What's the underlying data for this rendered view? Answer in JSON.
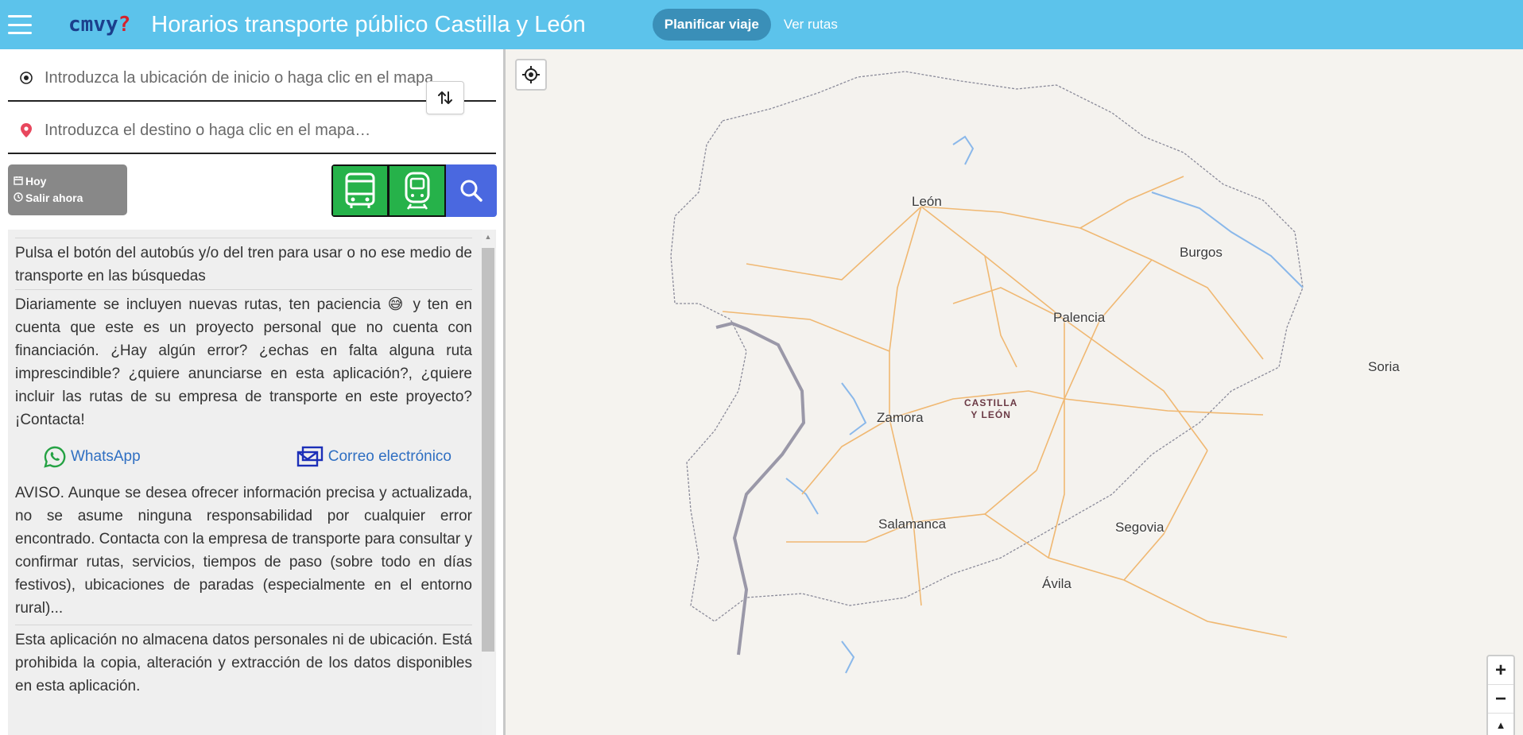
{
  "header": {
    "logo": {
      "part1": "cm",
      "part2": "vy",
      "part3": "?"
    },
    "title": "Horarios transporte público Castilla y León",
    "nav": {
      "plan": "Planificar viaje",
      "routes": "Ver rutas"
    }
  },
  "search": {
    "origin_placeholder": "Introduzca la ubicación de inicio o haga clic en el mapa",
    "destination_placeholder": "Introduzca el destino o haga clic en el mapa…",
    "when": {
      "date": "Hoy",
      "time": "Salir ahora"
    }
  },
  "info": {
    "tip": "Pulsa el botón del autobús y/o del tren para usar o no ese medio de transporte en las búsquedas",
    "news_before_emoji": "Diariamente se incluyen nuevas rutas, ten paciencia",
    "news_emoji": "😅",
    "news_after_emoji": "y ten en cuenta que este es un proyecto personal que no cuenta con financiación. ¿Hay algún error? ¿echas en falta alguna ruta imprescindible? ¿quiere anunciarse en esta aplicación?, ¿quiere incluir las rutas de su empresa de transporte en este proyecto? ¡Contacta!",
    "whatsapp": "WhatsApp",
    "email": "Correo electrónico",
    "warning": "AVISO. Aunque se desea ofrecer información precisa y actualizada, no se asume ninguna responsabilidad por cualquier error encontrado. Contacta con la empresa de transporte para consultar y confirmar rutas, servicios, tiempos de paso (sobre todo en días festivos), ubicaciones de paradas (especialmente en el entorno rural)...",
    "privacy": "Esta aplicación no almacena datos personales ni de ubicación. Está prohibida la copia, alteración y extracción de los datos disponibles en esta aplicación."
  },
  "map": {
    "cities": {
      "leon": "León",
      "burgos": "Burgos",
      "palencia": "Palencia",
      "soria": "Soria",
      "zamora": "Zamora",
      "salamanca": "Salamanca",
      "segovia": "Segovia",
      "avila": "Ávila"
    },
    "region_line1": "CASTILLA",
    "region_line2": "Y LEÓN",
    "zoom_in": "+",
    "zoom_out": "−",
    "compass": "▲"
  },
  "colors": {
    "header": "#5cc3eb",
    "bus_train": "#26b24a",
    "search": "#4a68e0",
    "roads": "#f0b872",
    "border": "#9a98a8"
  }
}
